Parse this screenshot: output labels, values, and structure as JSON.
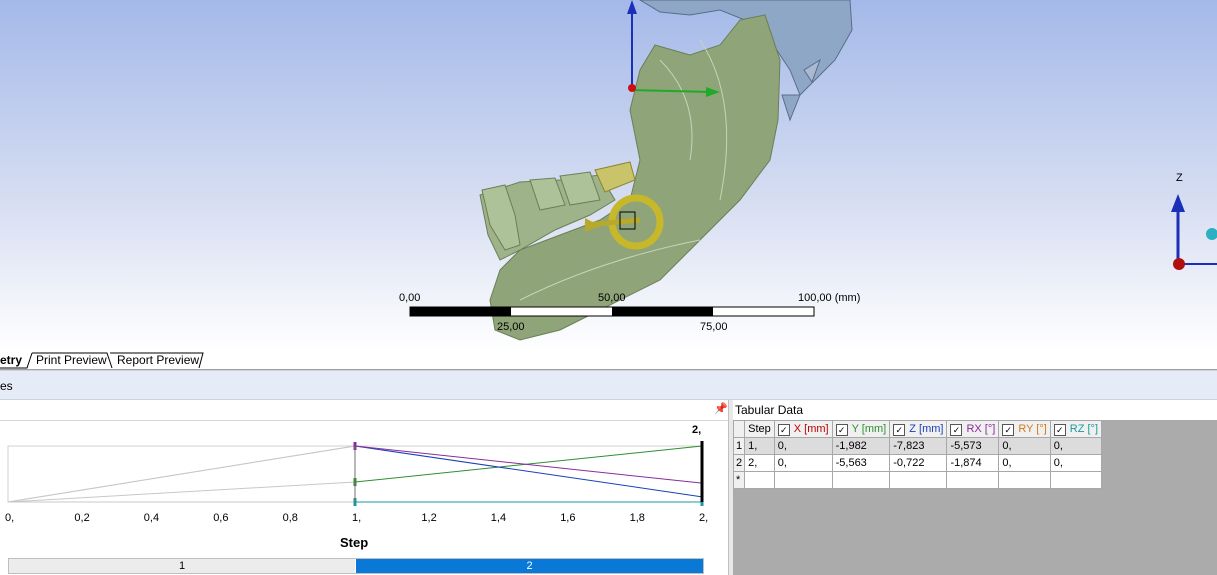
{
  "viewport": {
    "scale_bar": {
      "labels_top": [
        "0,00",
        "50,00",
        "100,00 (mm)"
      ],
      "labels_bottom": [
        "25,00",
        "75,00"
      ]
    },
    "triad_axis_label": "Z"
  },
  "tabs": [
    "etry",
    "Print Preview",
    "Report Preview"
  ],
  "panel_header": {
    "label": "es"
  },
  "graph": {
    "end_label": "2,",
    "xlabel": "Step",
    "x_ticks": [
      "0,",
      "0,2",
      "0,4",
      "0,6",
      "0,8",
      "1,",
      "1,2",
      "1,4",
      "1,6",
      "1,8",
      "2,"
    ],
    "steps": [
      "1",
      "2"
    ],
    "active_step": "2"
  },
  "tabular": {
    "title": "Tabular Data",
    "headers": [
      "Step",
      "X [mm]",
      "Y [mm]",
      "Z [mm]",
      "RX [°]",
      "RY [°]",
      "RZ [°]"
    ],
    "rows": [
      {
        "num": "1",
        "cells": [
          "1,",
          "0,",
          "-1,982",
          "-7,823",
          "-5,573",
          "0,",
          "0,"
        ]
      },
      {
        "num": "2",
        "cells": [
          "2,",
          "0,",
          "-5,563",
          "-0,722",
          "-1,874",
          "0,",
          "0,"
        ]
      }
    ],
    "new_row_marker": "*"
  },
  "chart_data": {
    "type": "line",
    "x": [
      0,
      1,
      2
    ],
    "xlabel": "Step",
    "xlim": [
      0,
      2
    ],
    "series": [
      {
        "name": "X [mm]",
        "color": "#c00000",
        "values": [
          0,
          0,
          0
        ]
      },
      {
        "name": "Y [mm]",
        "color": "#2f8f2f",
        "values": [
          0,
          -1.982,
          -5.563
        ]
      },
      {
        "name": "Z [mm]",
        "color": "#1a3fb8",
        "values": [
          0,
          -7.823,
          -0.722
        ]
      },
      {
        "name": "RX [°]",
        "color": "#8a2b9c",
        "values": [
          0,
          -5.573,
          -1.874
        ]
      },
      {
        "name": "RY [°]",
        "color": "#d07a1a",
        "values": [
          0,
          0,
          0
        ]
      },
      {
        "name": "RZ [°]",
        "color": "#1a9a9a",
        "values": [
          0,
          0,
          0
        ]
      }
    ]
  }
}
